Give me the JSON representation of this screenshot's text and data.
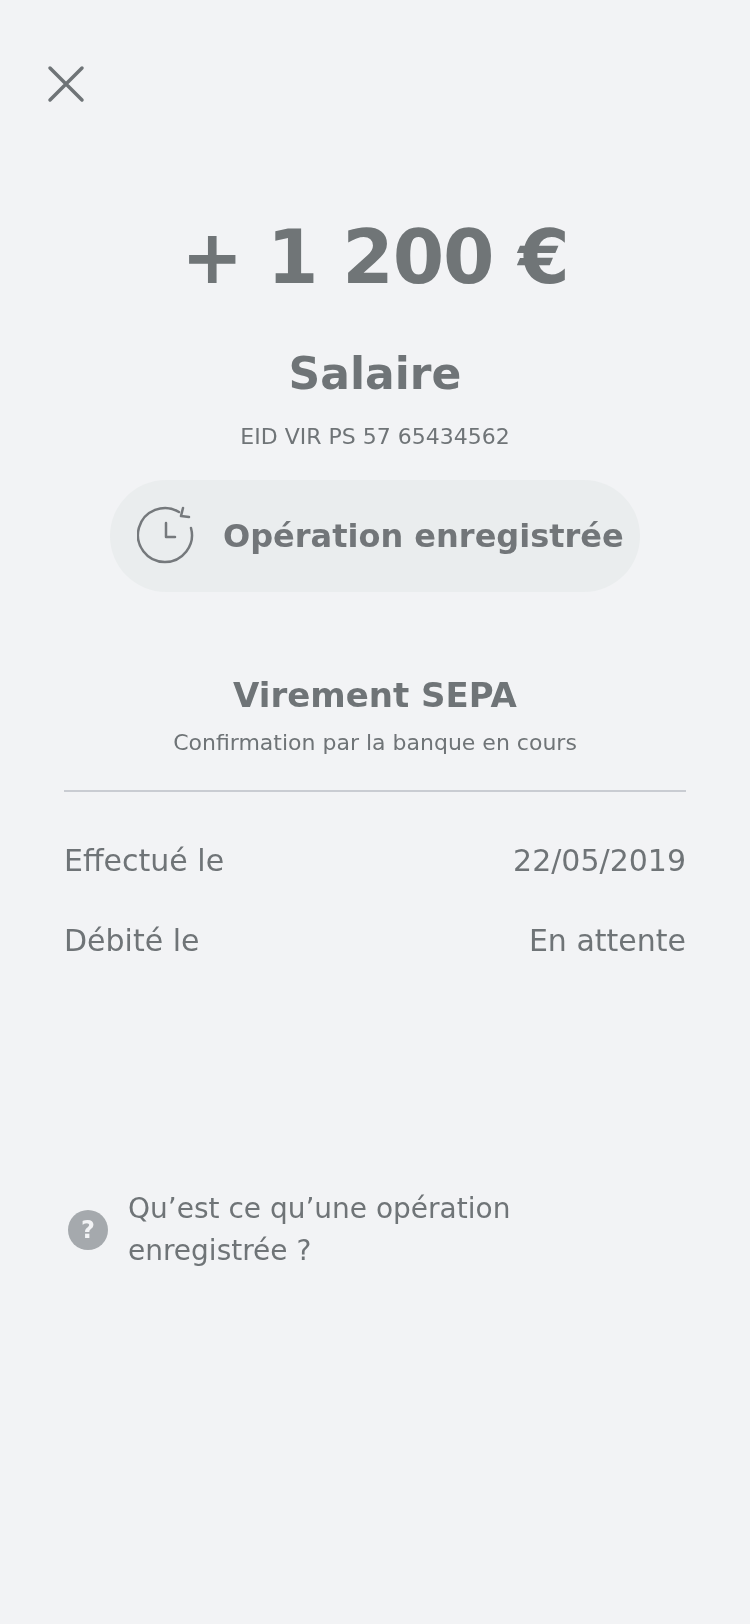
{
  "amount": "+ 1 200 €",
  "title": "Salaire",
  "reference": "EID VIR PS 57 65434562",
  "status": {
    "label": "Opération enregistrée"
  },
  "transfer": {
    "type": "Virement SEPA",
    "subtitle": "Confirmation par la banque en cours"
  },
  "details": [
    {
      "label": "Effectué le",
      "value": "22/05/2019"
    },
    {
      "label": "Débité le",
      "value": "En attente"
    }
  ],
  "help": {
    "icon": "?",
    "text": "Qu’est ce qu’une opération enregistrée ?"
  }
}
